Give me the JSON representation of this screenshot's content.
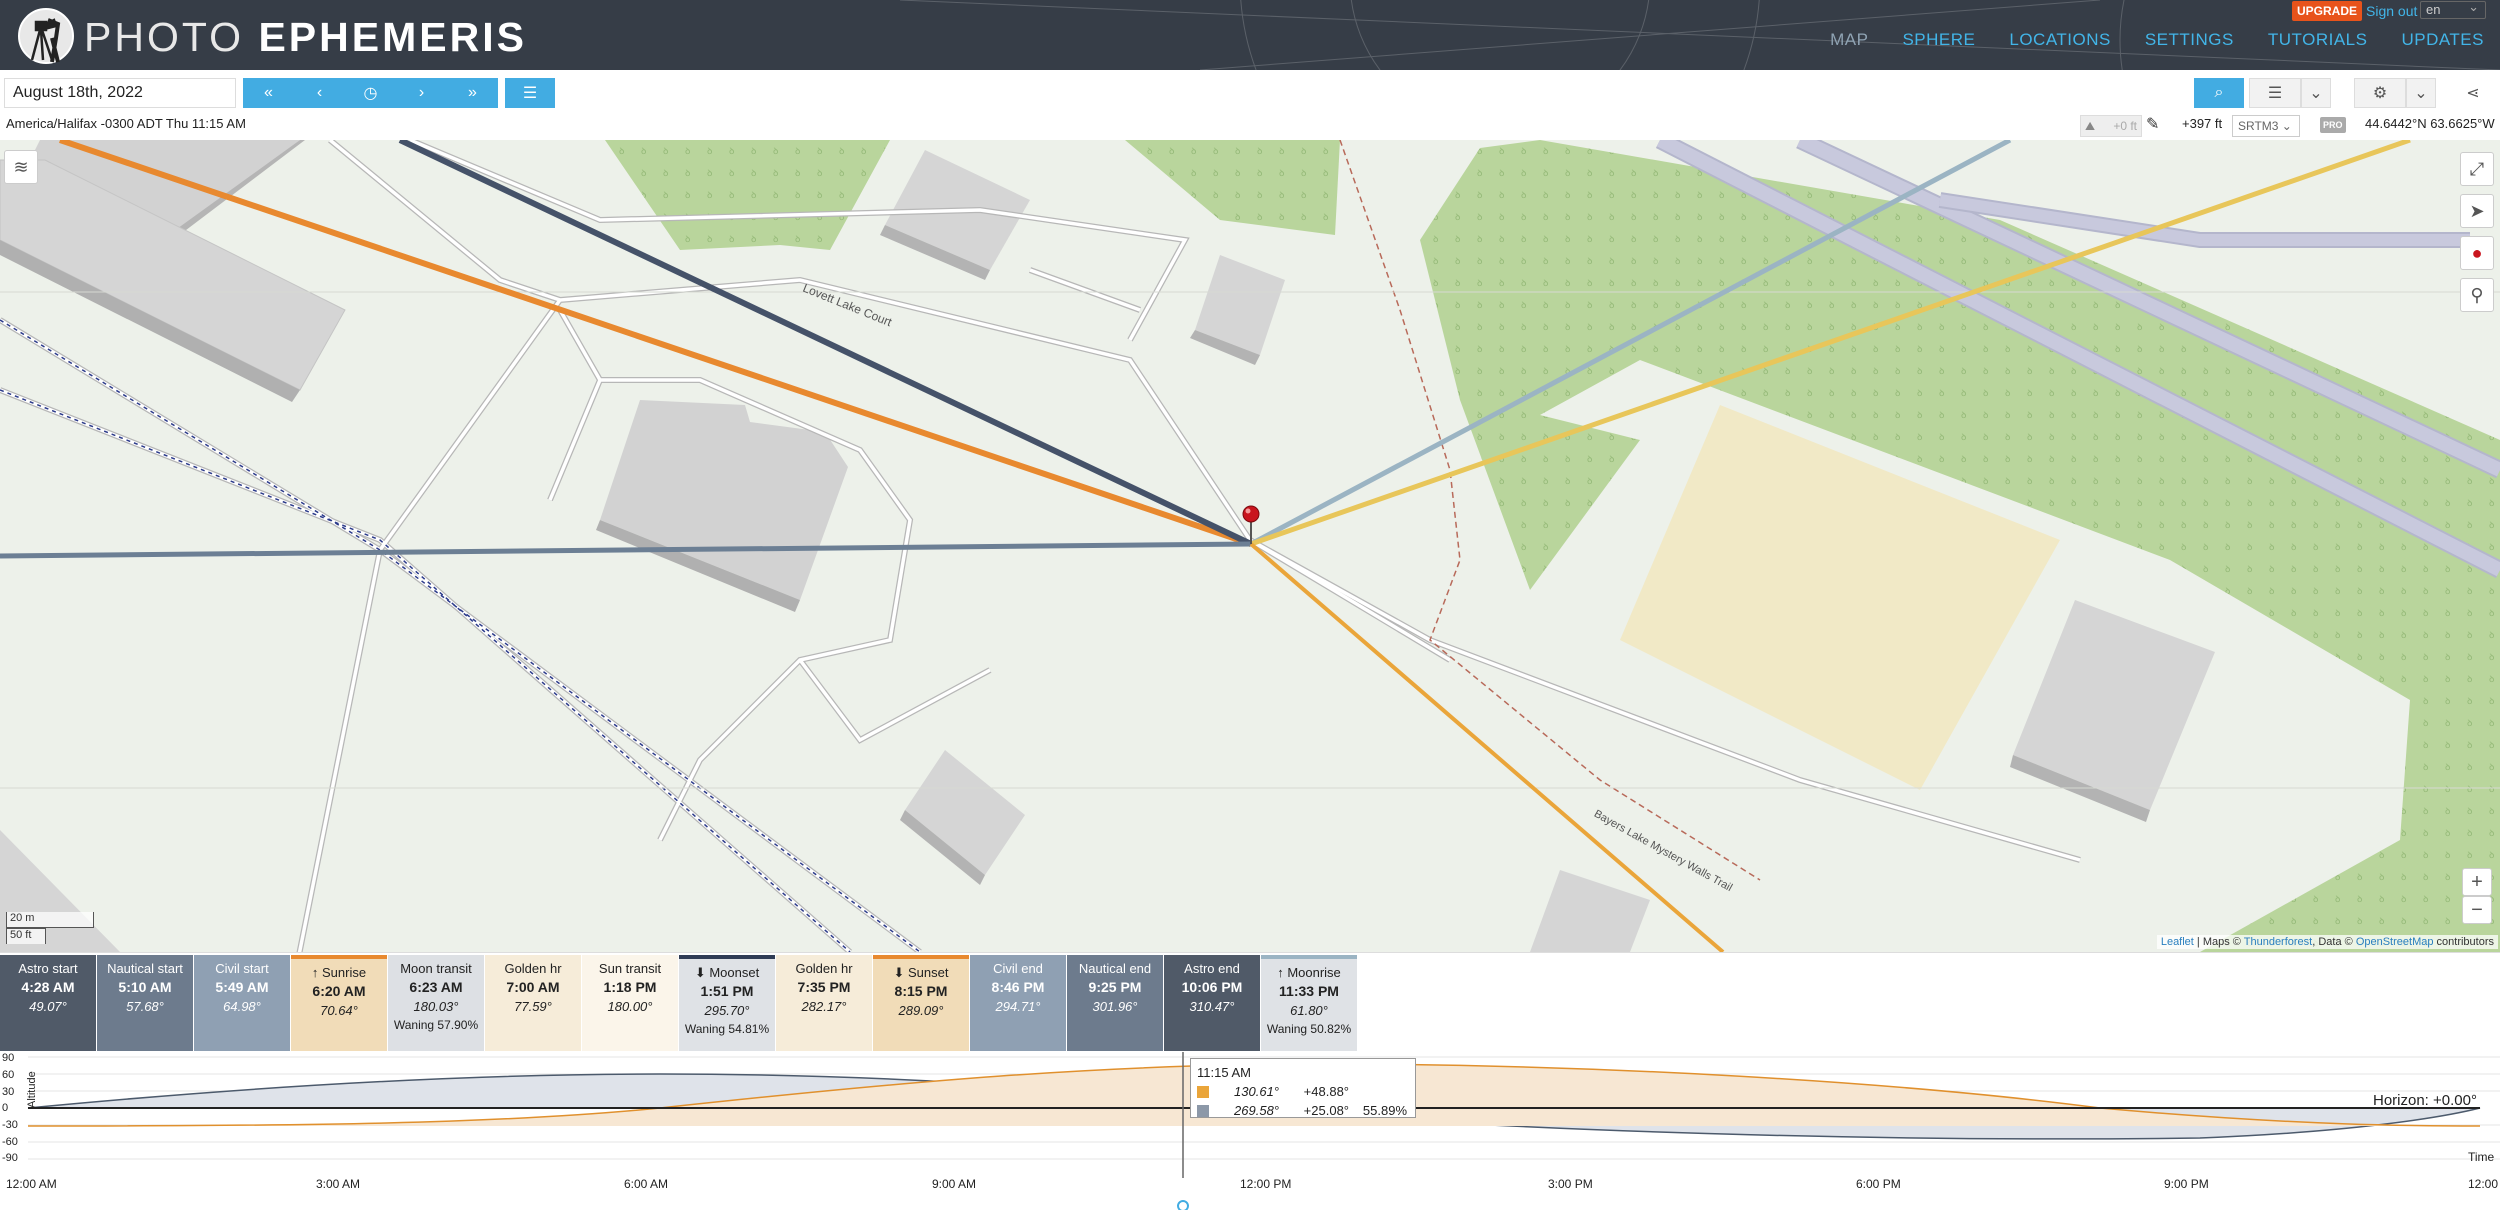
{
  "header": {
    "brand_light": "PHOTO",
    "brand_bold": "EPHEMERIS",
    "upgrade": "UPGRADE",
    "signout": "Sign out",
    "lang": "en",
    "nav": [
      "MAP",
      "SPHERE",
      "LOCATIONS",
      "SETTINGS",
      "TUTORIALS",
      "UPDATES"
    ]
  },
  "toolbar": {
    "date": "August 18th, 2022",
    "timezone": "America/Halifax -0300 ADT Thu 11:15 AM",
    "elev_offset": "+0 ft",
    "altitude": "+397 ft",
    "elevation_model": "SRTM3",
    "pro_badge": "PRO",
    "coords": "44.6442°N 63.6625°W"
  },
  "map": {
    "road_label_1": "Lovett Lake Court",
    "road_label_2": "Bayers Lake Mystery Walls Trail",
    "scale_m": "20 m",
    "scale_ft": "50 ft",
    "attrib_leaflet": "Leaflet",
    "attrib_mid": " | Maps © ",
    "attrib_tf": "Thunderforest",
    "attrib_data": ", Data © ",
    "attrib_osm": "OpenStreetMap",
    "attrib_end": " contributors",
    "colors": {
      "sunrise": "#e8892f",
      "sunset": "#eaa53a",
      "moonrise": "#9bb4c3",
      "moonset": "#455269",
      "sun_now": "#e8c65a",
      "moon_now": "#6c7f94"
    }
  },
  "events": [
    {
      "name": "Astro start",
      "time": "4:28 AM",
      "deg": "49.07°",
      "phase": "",
      "bg": "#505a68",
      "fg": "#fff"
    },
    {
      "name": "Nautical start",
      "time": "5:10 AM",
      "deg": "57.68°",
      "phase": "",
      "bg": "#6d7b8d",
      "fg": "#fff"
    },
    {
      "name": "Civil start",
      "time": "5:49 AM",
      "deg": "64.98°",
      "phase": "",
      "bg": "#8fa0b3",
      "fg": "#fff"
    },
    {
      "name": "↑ Sunrise",
      "time": "6:20 AM",
      "deg": "70.64°",
      "phase": "",
      "bg": "#f1dcb8",
      "fg": "#222"
    },
    {
      "name": "Moon transit",
      "time": "6:23 AM",
      "deg": "180.03°",
      "phase": "Waning 57.90%",
      "bg": "#dde0e4",
      "fg": "#222"
    },
    {
      "name": "Golden hr",
      "time": "7:00 AM",
      "deg": "77.59°",
      "phase": "",
      "bg": "#f6ecd9",
      "fg": "#222"
    },
    {
      "name": "Sun transit",
      "time": "1:18 PM",
      "deg": "180.00°",
      "phase": "",
      "bg": "#fbf5ea",
      "fg": "#222"
    },
    {
      "name": "⬇ Moonset",
      "time": "1:51 PM",
      "deg": "295.70°",
      "phase": "Waning 54.81%",
      "bg": "#dfe2e6",
      "fg": "#222"
    },
    {
      "name": "Golden hr",
      "time": "7:35 PM",
      "deg": "282.17°",
      "phase": "",
      "bg": "#f6ecd9",
      "fg": "#222"
    },
    {
      "name": "⬇ Sunset",
      "time": "8:15 PM",
      "deg": "289.09°",
      "phase": "",
      "bg": "#f1dcb8",
      "fg": "#222"
    },
    {
      "name": "Civil end",
      "time": "8:46 PM",
      "deg": "294.71°",
      "phase": "",
      "bg": "#8fa0b3",
      "fg": "#fff"
    },
    {
      "name": "Nautical end",
      "time": "9:25 PM",
      "deg": "301.96°",
      "phase": "",
      "bg": "#6d7b8d",
      "fg": "#fff"
    },
    {
      "name": "Astro end",
      "time": "10:06 PM",
      "deg": "310.47°",
      "phase": "",
      "bg": "#505a68",
      "fg": "#fff"
    },
    {
      "name": "↑ Moonrise",
      "time": "11:33 PM",
      "deg": "61.80°",
      "phase": "Waning 50.82%",
      "bg": "#dfe2e6",
      "fg": "#222"
    }
  ],
  "graph": {
    "y_labels": [
      "90",
      "60",
      "30",
      "0",
      "-30",
      "-60",
      "-90"
    ],
    "altitude_label": "Altitude",
    "time_label": "Time",
    "horizon": "Horizon: +0.00°",
    "x_ticks": [
      "12:00 AM",
      "3:00 AM",
      "6:00 AM",
      "9:00 AM",
      "12:00 PM",
      "3:00 PM",
      "6:00 PM",
      "9:00 PM",
      "12:00"
    ],
    "tooltip": {
      "time": "11:15 AM",
      "sun_az": "130.61°",
      "sun_alt": "+48.88°",
      "moon_az": "269.58°",
      "moon_alt": "+25.08°",
      "moon_phase": "55.89%"
    }
  }
}
